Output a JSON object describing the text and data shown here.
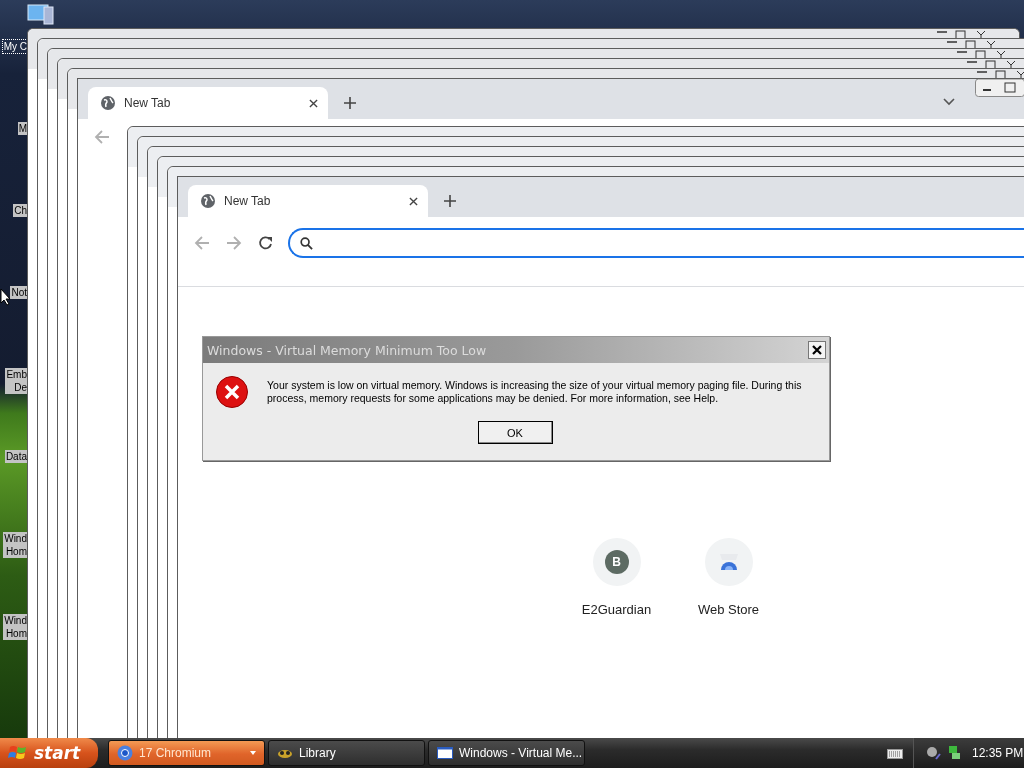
{
  "desktop_icons": [
    {
      "lines": [
        "My C"
      ],
      "focused": true
    },
    {
      "lines": [
        "M"
      ],
      "focused": false
    },
    {
      "lines": [
        "Ch"
      ],
      "focused": false
    },
    {
      "lines": [
        "Not"
      ],
      "focused": false
    },
    {
      "lines": [
        "Emb",
        "De"
      ],
      "focused": false
    },
    {
      "lines": [
        "Data"
      ],
      "focused": false
    },
    {
      "lines": [
        "Wind",
        "Hom"
      ],
      "focused": false
    },
    {
      "lines": [
        "Wind",
        "Hom"
      ],
      "focused": false
    }
  ],
  "back_browser": {
    "tab": {
      "title": "New Tab"
    }
  },
  "front_browser": {
    "tab": {
      "title": "New Tab"
    },
    "shortcuts": [
      {
        "label": "E2Guardian",
        "kind": "letter",
        "letter": "B"
      },
      {
        "label": "Web Store",
        "kind": "store"
      }
    ]
  },
  "dialog": {
    "title": "Windows - Virtual Memory Minimum Too Low",
    "message": "Your system is low on virtual memory. Windows is increasing the size of your virtual memory paging file. During this process, memory requests for some applications may be denied. For more information, see Help.",
    "button": "OK"
  },
  "taskbar": {
    "start": "start",
    "tasks": [
      {
        "label": "17 Chromium",
        "kind": "chromium",
        "selected": true
      },
      {
        "label": "Library",
        "kind": "library",
        "selected": false
      },
      {
        "label": "Windows - Virtual Me...",
        "kind": "window",
        "selected": false
      }
    ],
    "clock": "12:35 PM"
  }
}
